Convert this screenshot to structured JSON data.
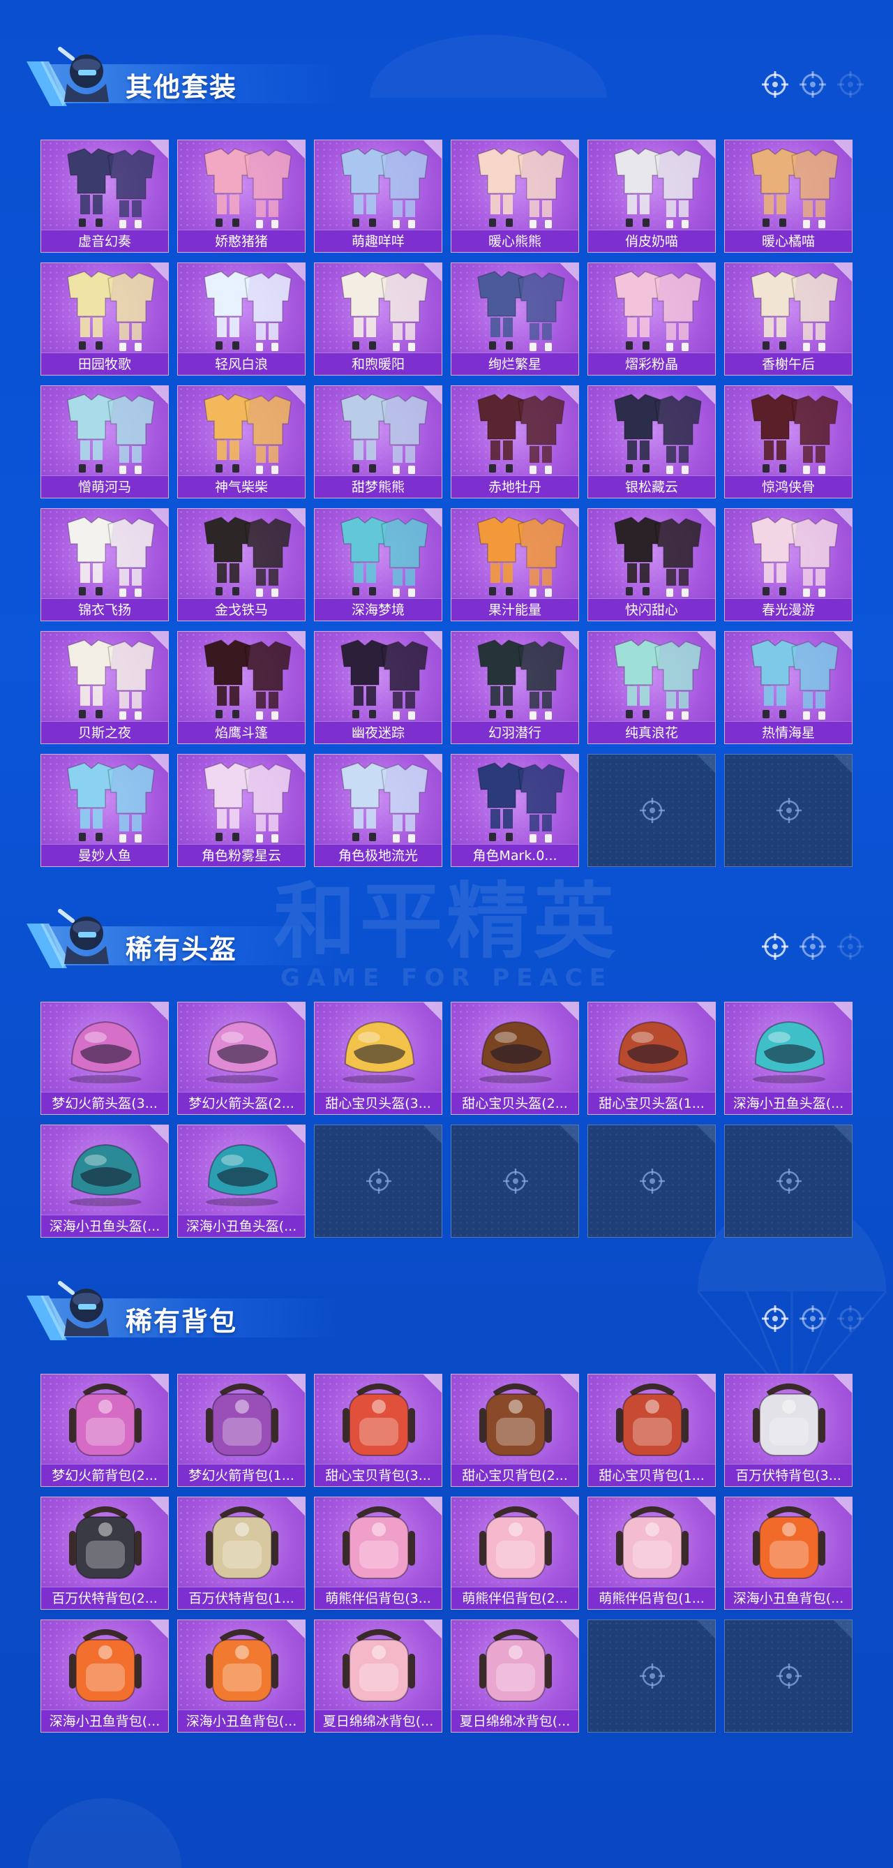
{
  "sections": [
    {
      "title": "其他套装",
      "kind": "suit",
      "items": [
        {
          "label": "虚音幻奏",
          "color": "#3b3b6e"
        },
        {
          "label": "娇憨猪猪",
          "color": "#f2a7c3"
        },
        {
          "label": "萌趣咩咩",
          "color": "#a9c6f0"
        },
        {
          "label": "暖心熊熊",
          "color": "#f5d6c8"
        },
        {
          "label": "俏皮奶喵",
          "color": "#e8e8ec"
        },
        {
          "label": "暖心橘喵",
          "color": "#e9b07a"
        },
        {
          "label": "田园牧歌",
          "color": "#efe4a6"
        },
        {
          "label": "轻风白浪",
          "color": "#e8f2ff"
        },
        {
          "label": "和煦暖阳",
          "color": "#f4ede4"
        },
        {
          "label": "绚烂繁星",
          "color": "#4a5a9a"
        },
        {
          "label": "熠彩粉晶",
          "color": "#f3c3dc"
        },
        {
          "label": "香榭午后",
          "color": "#f1e4d2"
        },
        {
          "label": "憎萌河马",
          "color": "#a9dbe8"
        },
        {
          "label": "神气柴柴",
          "color": "#f2b85a"
        },
        {
          "label": "甜梦熊熊",
          "color": "#b9cde8"
        },
        {
          "label": "赤地牡丹",
          "color": "#5a2530"
        },
        {
          "label": "银松藏云",
          "color": "#2c2d4a"
        },
        {
          "label": "惊鸿侠骨",
          "color": "#5a1f28"
        },
        {
          "label": "锦衣飞扬",
          "color": "#f4f2ef"
        },
        {
          "label": "金戈铁马",
          "color": "#2d2626"
        },
        {
          "label": "深海梦境",
          "color": "#62c7d8"
        },
        {
          "label": "果汁能量",
          "color": "#f29a3a"
        },
        {
          "label": "快闪甜心",
          "color": "#2a2226"
        },
        {
          "label": "春光漫游",
          "color": "#f2d6e6"
        },
        {
          "label": "贝斯之夜",
          "color": "#f4efe6"
        },
        {
          "label": "焰鹰斗篷",
          "color": "#3a1820"
        },
        {
          "label": "幽夜迷踪",
          "color": "#2b1f3a"
        },
        {
          "label": "幻羽潜行",
          "color": "#26343a"
        },
        {
          "label": "纯真浪花",
          "color": "#9ee0d8"
        },
        {
          "label": "热情海星",
          "color": "#7ec8e8"
        },
        {
          "label": "曼妙人鱼",
          "color": "#8ad2f0"
        },
        {
          "label": "角色粉雾星云",
          "color": "#f0d8f2"
        },
        {
          "label": "角色极地流光",
          "color": "#c9dcf6"
        },
        {
          "label": "角色Mark.0...",
          "color": "#2a3a7a"
        },
        {
          "label": "",
          "empty": true
        },
        {
          "label": "",
          "empty": true
        }
      ]
    },
    {
      "title": "稀有头盔",
      "kind": "helmet",
      "items": [
        {
          "label": "梦幻火箭头盔(3...",
          "color": "#d66fc8"
        },
        {
          "label": "梦幻火箭头盔(2...",
          "color": "#e08ad6"
        },
        {
          "label": "甜心宝贝头盔(3...",
          "color": "#f2c24a"
        },
        {
          "label": "甜心宝贝头盔(2...",
          "color": "#7a4422"
        },
        {
          "label": "甜心宝贝头盔(1...",
          "color": "#b84a2e"
        },
        {
          "label": "深海小丑鱼头盔(...",
          "color": "#3fc0c9"
        },
        {
          "label": "深海小丑鱼头盔(...",
          "color": "#2a8a96"
        },
        {
          "label": "深海小丑鱼头盔(...",
          "color": "#2aa0b2"
        },
        {
          "label": "",
          "empty": true
        },
        {
          "label": "",
          "empty": true
        },
        {
          "label": "",
          "empty": true
        },
        {
          "label": "",
          "empty": true
        }
      ]
    },
    {
      "title": "稀有背包",
      "kind": "backpack",
      "items": [
        {
          "label": "梦幻火箭背包(2...",
          "color": "#d56bc4"
        },
        {
          "label": "梦幻火箭背包(1...",
          "color": "#9a4fb8"
        },
        {
          "label": "甜心宝贝背包(3...",
          "color": "#e0503a"
        },
        {
          "label": "甜心宝贝背包(2...",
          "color": "#8a4a2a"
        },
        {
          "label": "甜心宝贝背包(1...",
          "color": "#c84a32"
        },
        {
          "label": "百万伏特背包(3...",
          "color": "#e2e2e8"
        },
        {
          "label": "百万伏特背包(2...",
          "color": "#3a3a44"
        },
        {
          "label": "百万伏特背包(1...",
          "color": "#d8c8a0"
        },
        {
          "label": "萌熊伴侣背包(3...",
          "color": "#f0a0c8"
        },
        {
          "label": "萌熊伴侣背包(2...",
          "color": "#f6b8cc"
        },
        {
          "label": "萌熊伴侣背包(1...",
          "color": "#f3bcd0"
        },
        {
          "label": "深海小丑鱼背包(...",
          "color": "#f26a2a"
        },
        {
          "label": "深海小丑鱼背包(...",
          "color": "#f36f2e"
        },
        {
          "label": "深海小丑鱼背包(...",
          "color": "#f27a30"
        },
        {
          "label": "夏日绵绵冰背包(...",
          "color": "#f4b8c8"
        },
        {
          "label": "夏日绵绵冰背包(...",
          "color": "#e9a6cf"
        },
        {
          "label": "",
          "empty": true
        },
        {
          "label": "",
          "empty": true
        }
      ]
    }
  ],
  "watermark": {
    "title": "和平精英",
    "subtitle": "GAME FOR PEACE"
  },
  "theme": {
    "background": "#0b55d8",
    "card": "#a759df",
    "label_bar": "#7d2fd0",
    "empty_card": "#1e3f78"
  }
}
